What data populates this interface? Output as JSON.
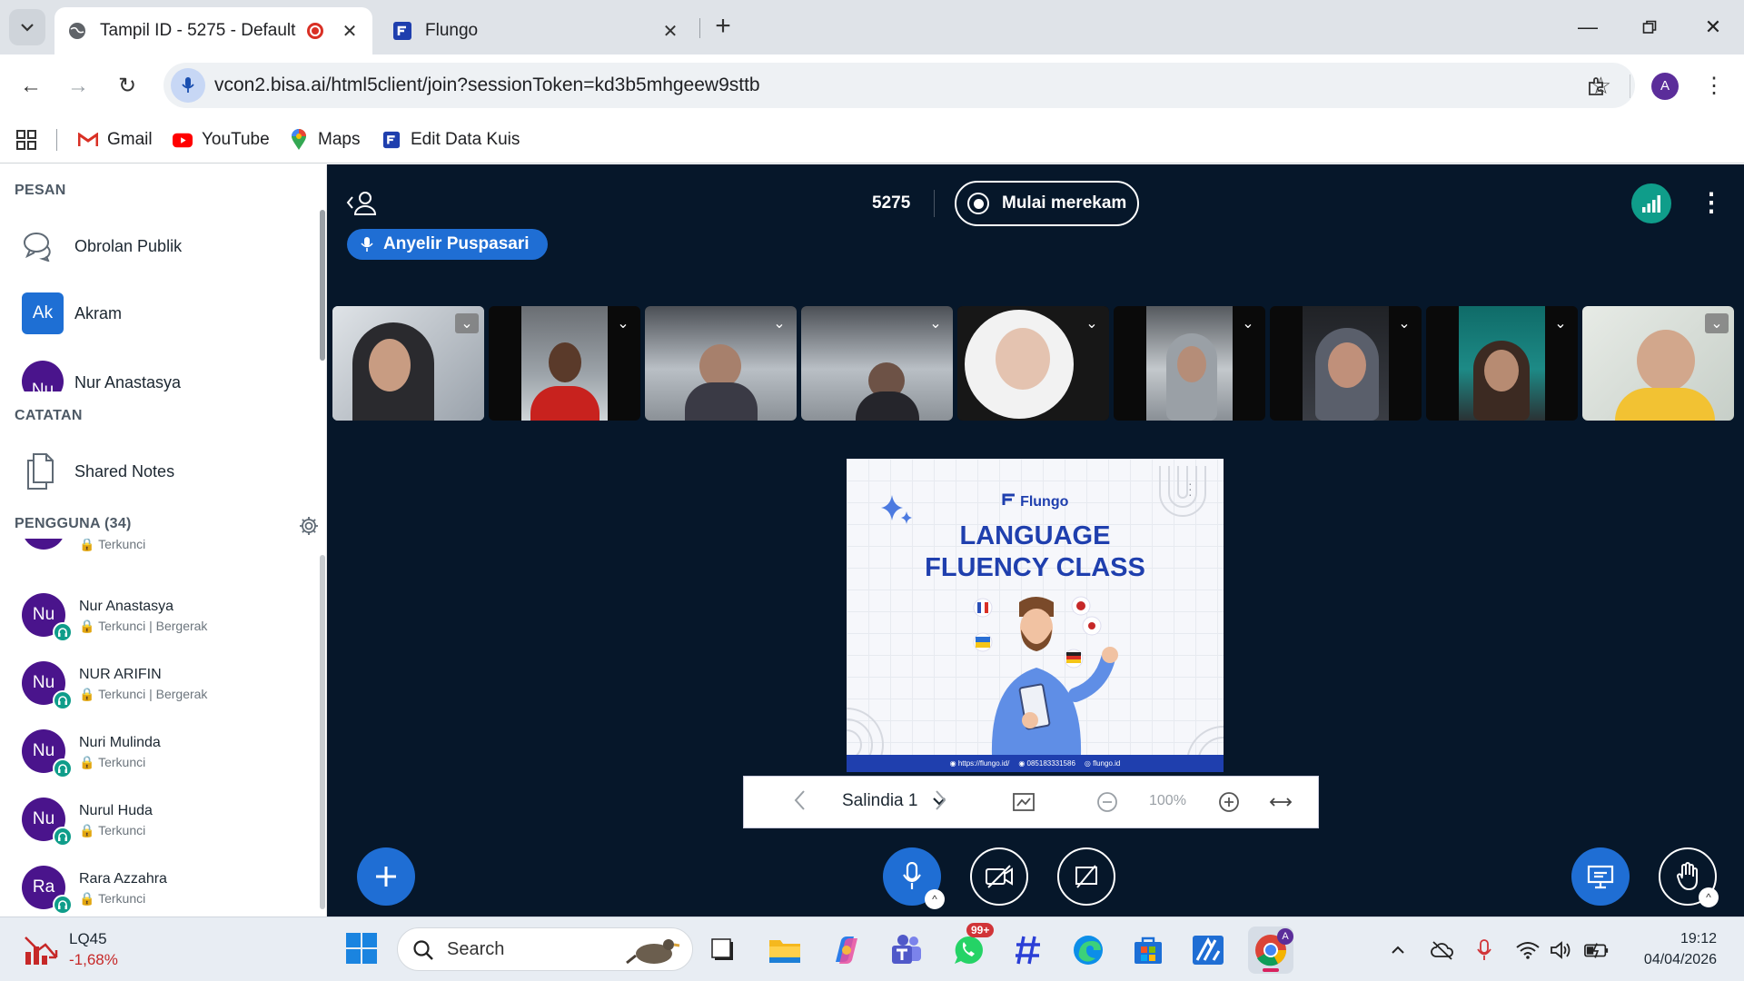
{
  "browser": {
    "tabs": [
      {
        "title": "Tampil ID - 5275 - Default",
        "active": true
      },
      {
        "title": "Flungo",
        "active": false
      }
    ],
    "url": "vcon2.bisa.ai/html5client/join?sessionToken=kd3b5mhgeew9sttb",
    "profile_initial": "A",
    "bookmarks": [
      "Gmail",
      "YouTube",
      "Maps",
      "Edit Data Kuis"
    ]
  },
  "sidebar": {
    "messages_title": "PESAN",
    "public_chat": "Obrolan Publik",
    "chats": [
      {
        "initials": "Ak",
        "name": "Akram"
      },
      {
        "initials": "Nu",
        "name": "Nur Anastasya"
      }
    ],
    "notes_title": "CATATAN",
    "shared_notes": "Shared Notes",
    "users_title": "PENGGUNA (34)",
    "partial_status": "Terkunci",
    "users": [
      {
        "initials": "Nu",
        "name": "Nur Anastasya",
        "status": "Terkunci | Bergerak"
      },
      {
        "initials": "Nu",
        "name": "NUR ARIFIN",
        "status": "Terkunci | Bergerak"
      },
      {
        "initials": "Nu",
        "name": "Nuri Mulinda",
        "status": "Terkunci"
      },
      {
        "initials": "Nu",
        "name": "Nurul Huda",
        "status": "Terkunci"
      },
      {
        "initials": "Ra",
        "name": "Rara Azzahra",
        "status": "Terkunci"
      }
    ]
  },
  "meeting": {
    "conference_name": "5275",
    "record_label": "Mulai merekam",
    "talking": "Anyelir Puspasari",
    "colors": {
      "background": "#06172a",
      "primary": "#1f6ed4",
      "connection": "#0f9d8a"
    }
  },
  "slide": {
    "brand": "Flungo",
    "headline_line1": "LANGUAGE",
    "headline_line2": "FLUENCY CLASS",
    "footer_web": "https://flungo.id/",
    "footer_phone": "085183331586",
    "footer_social": "flungo.id"
  },
  "presentation_bar": {
    "slide_label": "Salindia 1",
    "zoom": "100%"
  },
  "taskbar": {
    "stock_name": "LQ45",
    "stock_change": "-1,68%",
    "search_placeholder": "Search",
    "whatsapp_badge": "99+",
    "time": "19:12",
    "date": "04/04/2026"
  }
}
